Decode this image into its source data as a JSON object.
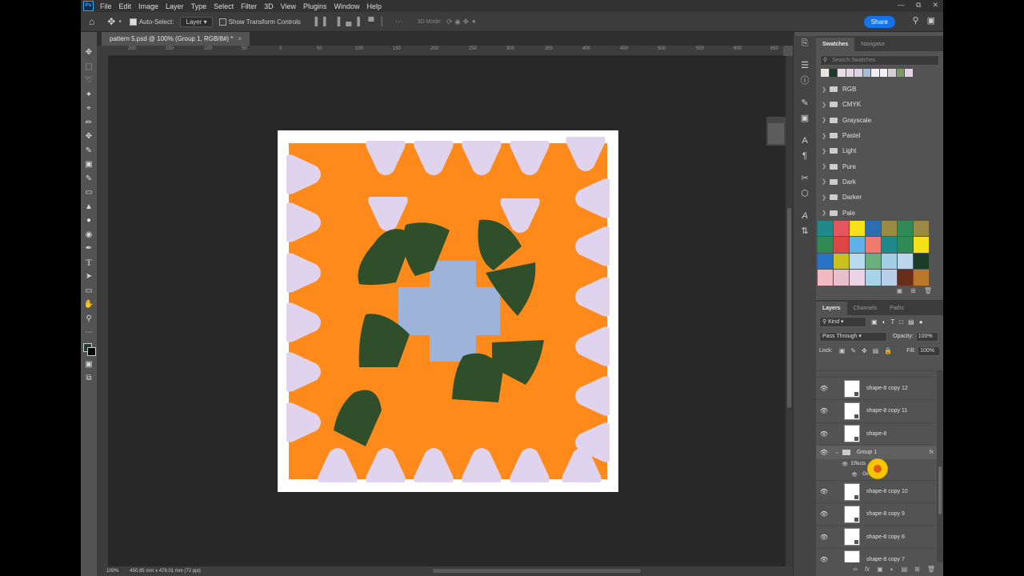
{
  "menu": [
    "File",
    "Edit",
    "Image",
    "Layer",
    "Type",
    "Select",
    "Filter",
    "3D",
    "View",
    "Plugins",
    "Window",
    "Help"
  ],
  "options": {
    "auto_select": "Auto-Select:",
    "auto_select_target": "Layer",
    "show_transform": "Show Transform Controls",
    "mode_3d": "3D Mode:",
    "share": "Share"
  },
  "document": {
    "tab_title": "pattern 5.psd @ 100% (Group 1, RGB/8#) *"
  },
  "ruler_ticks": [
    "200",
    "150",
    "100",
    "50",
    "0",
    "50",
    "100",
    "150",
    "200",
    "250",
    "300",
    "350",
    "400",
    "450",
    "500",
    "550",
    "600",
    "650"
  ],
  "status": {
    "zoom": "100%",
    "dimensions": "450.85 mm x 478.01 mm (72 ppi)"
  },
  "swatches_panel": {
    "tabs": [
      "Swatches",
      "Navigator"
    ],
    "search_placeholder": "Search Swatches",
    "recent_colors": [
      "#e9e3df",
      "#1d3a2b",
      "#e6dfe6",
      "#e4d9e3",
      "#d9d3e4",
      "#a7bbdf",
      "#f0eef0",
      "#f3f0f3",
      "#d8cfd6",
      "#7a9a62",
      "#e3d2e6"
    ],
    "groups": [
      "RGB",
      "CMYK",
      "Grayscale",
      "Pastel",
      "Light",
      "Pure",
      "Dark",
      "Darker",
      "Pale"
    ],
    "grid_colors": [
      "#1e8a8c",
      "#e6545c",
      "#f7e21a",
      "#2a6fb2",
      "#9b8a44",
      "#2f8a55",
      "#9b8a44",
      "#2f8a55",
      "#de4646",
      "#5fb2e6",
      "#f07a6e",
      "#1e8a8c",
      "#2f8a55",
      "#f5e11a",
      "#2873c6",
      "#c9c01b",
      "#b8dced",
      "#69b07c",
      "#a3cfe6",
      "#bcd6ee",
      "#1c3d28",
      "#f3b9c3",
      "#e8c0cd",
      "#e9d3e4",
      "#a6d3e6",
      "#b9cfe9",
      "#6a2d19",
      "#b9782b"
    ]
  },
  "layers_panel": {
    "tabs": [
      "Layers",
      "Channels",
      "Paths"
    ],
    "filter_kind": "Kind",
    "blend_mode": "Pass Through",
    "opacity_label": "Opacity:",
    "opacity_value": "100%",
    "lock_label": "Lock:",
    "fill_label": "Fill:",
    "fill_value": "100%",
    "layers": [
      {
        "name": "shape-8 copy 12"
      },
      {
        "name": "shape-8 copy 11"
      },
      {
        "name": "shape-8"
      },
      {
        "name": "Group 1"
      },
      {
        "name": "Effects"
      },
      {
        "name": "Overlay"
      },
      {
        "name": "shape-8 copy 10"
      },
      {
        "name": "shape-8 copy 9"
      },
      {
        "name": "shape-8 copy 8"
      },
      {
        "name": "shape-8 copy 7"
      }
    ]
  },
  "colors": {
    "orange": "#ff8a1c",
    "lavender": "#e0d3ee",
    "dark_green": "#2f4f2b",
    "light_blue": "#9db3d9",
    "accent": "#1473e6"
  }
}
